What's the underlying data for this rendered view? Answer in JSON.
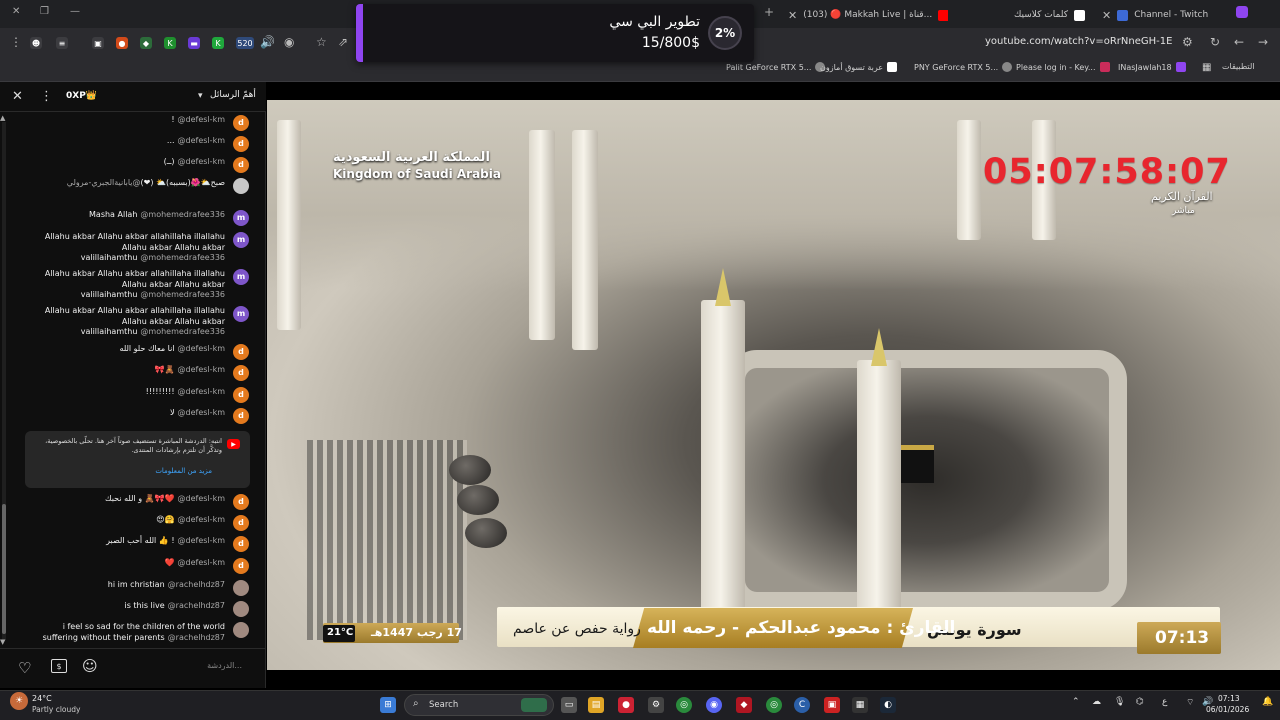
{
  "browser": {
    "tabs": [
      {
        "label": "",
        "x": 0
      },
      {
        "label": "(103) 🔴 Makkah Live | قناة...",
        "x": 0
      },
      {
        "label": "كلمات كلاسيك",
        "x": 0
      },
      {
        "label": "Channel - Twitch",
        "x": 0
      }
    ],
    "url": "youtube.com/watch?v=oRrNneGH-1E",
    "ext_badge": "520",
    "bookmarks": [
      {
        "label": "Palit GeForce RTX 5..."
      },
      {
        "label": "عربة تسوق أمازون"
      },
      {
        "label": "PNY GeForce RTX 5..."
      },
      {
        "label": "Please log in - Key..."
      },
      {
        "label": "INasJawlah18"
      },
      {
        "label": "التطبيقات"
      }
    ]
  },
  "donation": {
    "title": "تطوير البي سي",
    "amount": "15/800$",
    "percent": "2%",
    "progress": 0.02,
    "accent": "#8f45f0"
  },
  "chat": {
    "header": {
      "filter": "أهمّ الرسائل",
      "points": "0XP👑"
    },
    "messages": [
      {
        "author": "@defesl-km",
        "text": "!",
        "avatar": "d",
        "color": "#e47a1e"
      },
      {
        "author": "@defesl-km",
        "text": "...",
        "avatar": "d",
        "color": "#e47a1e"
      },
      {
        "author": "@defesl-km",
        "text": "(ــ)",
        "avatar": "d",
        "color": "#e47a1e"
      },
      {
        "author": "@يابانيةالجبري-مرولي",
        "text": "صبح⛅🌺(بسببه)⛅ (❤)",
        "avatar": "",
        "color": "#c7c7c7"
      },
      {
        "author": "@mohemedrafee336",
        "text": "Masha Allah",
        "avatar": "m",
        "color": "#7e56c9"
      },
      {
        "author": "@mohemedrafee336",
        "text": "Allahu akbar Allahu akbar allahillaha illallahu Allahu akbar Allahu akbar valillaihamthu",
        "avatar": "m",
        "color": "#7e56c9"
      },
      {
        "author": "@mohemedrafee336",
        "text": "Allahu akbar Allahu akbar allahillaha illallahu Allahu akbar Allahu akbar valillaihamthu",
        "avatar": "m",
        "color": "#7e56c9"
      },
      {
        "author": "@mohemedrafee336",
        "text": "Allahu akbar Allahu akbar allahillaha illallahu Allahu akbar Allahu akbar valillaihamthu",
        "avatar": "m",
        "color": "#7e56c9"
      },
      {
        "author": "@defesl-km",
        "text": "انا معاك حلو الله",
        "avatar": "d",
        "color": "#e47a1e"
      },
      {
        "author": "@defesl-km",
        "text": "🎀🧸",
        "avatar": "d",
        "color": "#e47a1e"
      },
      {
        "author": "@defesl-km",
        "text": "!!!!!!!!!",
        "avatar": "d",
        "color": "#e47a1e"
      },
      {
        "author": "@defesl-km",
        "text": "لا",
        "avatar": "d",
        "color": "#e47a1e"
      }
    ],
    "notice": {
      "text": "انتبه: الدردشة المباشرة تستضيف صوتاً آخر هنا. تحلّى بالخصوصية، وتذكَّر أن تلتزم بإرشادات المنتدى.",
      "link": "مزيد من المعلومات"
    },
    "messages2": [
      {
        "author": "@defesl-km",
        "text": "و الله نحبك 🧸🎀❤️",
        "avatar": "d",
        "color": "#e47a1e"
      },
      {
        "author": "@defesl-km",
        "text": "😍🤗",
        "avatar": "d",
        "color": "#e47a1e"
      },
      {
        "author": "@defesl-km",
        "text": "الله أحب الصبر 👍 !",
        "avatar": "d",
        "color": "#e47a1e"
      },
      {
        "author": "@defesl-km",
        "text": "❤️",
        "avatar": "d",
        "color": "#e47a1e"
      },
      {
        "author": "@rachelhdz87",
        "text": "hi im christian",
        "avatar": "",
        "color": "#a08a80"
      },
      {
        "author": "@rachelhdz87",
        "text": "is this live",
        "avatar": "",
        "color": "#a08a80"
      },
      {
        "author": "@rachelhdz87",
        "text": "i feel so sad for the children of the world suffering without their parents",
        "avatar": "",
        "color": "#a08a80"
      }
    ],
    "input_placeholder": "الدردشة..."
  },
  "video": {
    "ksa_ar": "المملكة العربية السعودية",
    "ksa_en": "Kingdom of Saudi Arabia",
    "countdown": "05:07:58:07",
    "channel": "القرآن الكريم",
    "live": "مباشر",
    "surah": "سورة يونس",
    "qari": "القارئ : محمود عبدالحكم - رحمه الله",
    "rewaya": "رواية حفص عن عاصم",
    "hijri_date": "17 رجب 1447هـ",
    "temperature": "21°C",
    "clock": "07:13",
    "countdown_color": "#e8262e"
  },
  "taskbar": {
    "weather_temp": "24°C",
    "weather_desc": "Partly cloudy",
    "search": "Search",
    "time": "07:13",
    "date": "06/01/2026",
    "lang": "ع"
  }
}
